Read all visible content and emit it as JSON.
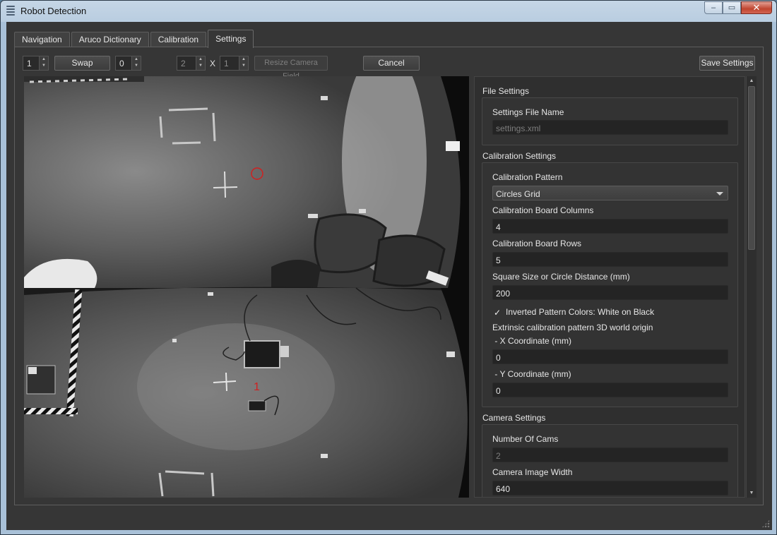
{
  "window": {
    "title": "Robot Detection"
  },
  "tabs": [
    {
      "label": "Navigation",
      "active": false
    },
    {
      "label": "Aruco Dictionary",
      "active": false
    },
    {
      "label": "Calibration",
      "active": false
    },
    {
      "label": "Settings",
      "active": true
    }
  ],
  "toolbar": {
    "camera_a": "1",
    "swap_label": "Swap",
    "camera_b": "0",
    "field_cols": "2",
    "x_label": "X",
    "field_rows": "1",
    "resize_label": "Resize Camera Field",
    "cancel_label": "Cancel",
    "save_label": "Save Settings"
  },
  "camera_view": {
    "marker_label": "1",
    "marker_color": "#d02020"
  },
  "settings": {
    "file": {
      "title": "File Settings",
      "file_name_label": "Settings File Name",
      "file_name_value": "settings.xml"
    },
    "calibration": {
      "title": "Calibration Settings",
      "pattern_label": "Calibration Pattern",
      "pattern_value": "Circles Grid",
      "columns_label": "Calibration Board Columns",
      "columns_value": "4",
      "rows_label": "Calibration Board Rows",
      "rows_value": "5",
      "square_size_label": "Square Size or Circle Distance (mm)",
      "square_size_value": "200",
      "inverted_label": "Inverted Pattern Colors: White on Black",
      "inverted_checked": true,
      "checkmark": "✓",
      "origin_label": "Extrinsic calibration pattern 3D world origin",
      "x_coord_label": " - X Coordinate (mm)",
      "x_coord_value": "0",
      "y_coord_label": " - Y Coordinate (mm)",
      "y_coord_value": "0"
    },
    "camera": {
      "title": "Camera Settings",
      "num_cams_label": "Number Of Cams",
      "num_cams_value": "2",
      "width_label": "Camera Image Width",
      "width_value": "640"
    }
  }
}
